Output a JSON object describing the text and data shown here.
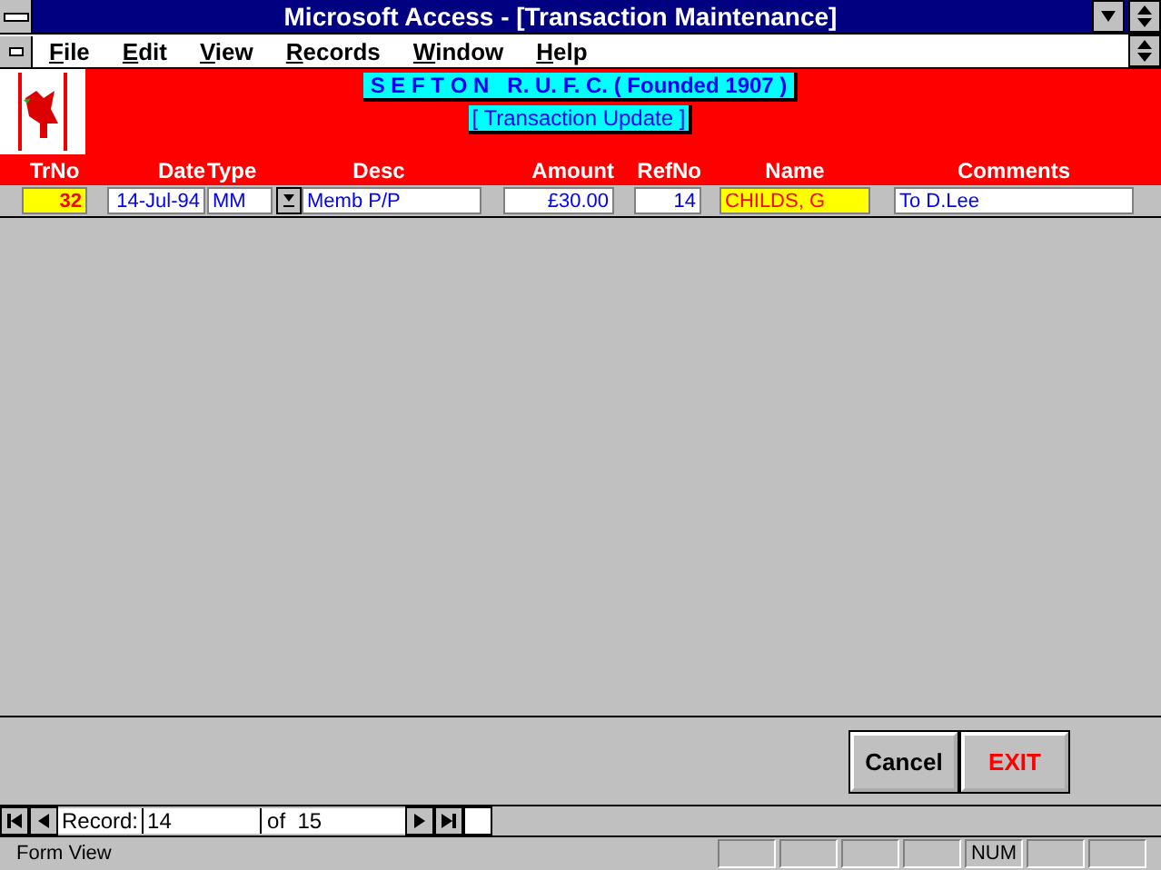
{
  "window": {
    "title": "Microsoft Access - [Transaction Maintenance]"
  },
  "menu": [
    "File",
    "Edit",
    "View",
    "Records",
    "Window",
    "Help"
  ],
  "header": {
    "club": "S E F T O N   R. U. F. C. ( Founded 1907 )",
    "subtitle": "[ Transaction Update ]"
  },
  "columns": [
    {
      "header": "TrNo",
      "value": "32",
      "kind": "highlight"
    },
    {
      "header": "Date",
      "value": "14-Jul-94",
      "kind": "plain"
    },
    {
      "header": "Type",
      "value": "MM",
      "kind": "plain"
    },
    {
      "header": "Desc",
      "value": "Memb P/P",
      "kind": "combo"
    },
    {
      "header": "Amount",
      "value": "£30.00",
      "kind": "plain"
    },
    {
      "header": "RefNo",
      "value": "14",
      "kind": "plain"
    },
    {
      "header": "Name",
      "value": "CHILDS, G",
      "kind": "highlight"
    },
    {
      "header": "Comments",
      "value": "To D.Lee",
      "kind": "plain"
    }
  ],
  "buttons": [
    {
      "label": "Cancel",
      "kind": "normal"
    },
    {
      "label": "EXIT",
      "kind": "danger"
    }
  ],
  "navigation": {
    "label": "Record:",
    "current": "14",
    "total": "of  15"
  },
  "status_bar": {
    "text": "Form View",
    "indicator": "NUM"
  }
}
